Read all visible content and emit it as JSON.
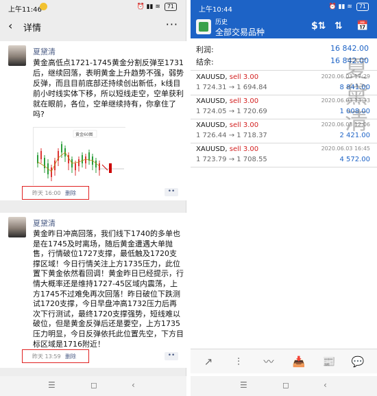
{
  "left": {
    "status": {
      "time": "上午11:46",
      "battery": "71"
    },
    "nav": {
      "back": "‹",
      "title": "详情",
      "more": "···"
    },
    "posts": [
      {
        "user": "夏黛清",
        "text": "黄金高低点1721-1745黄金分割反弹至1731后，继续回落，表明黄金上升趋势不强，弱势反弹，而且目前底部还持续创出新低，k线目前小时线实体下移，所以短线走空，空单获利就在眼前，各位，空单继续持有，你拿住了吗?",
        "time": "昨天 16:00",
        "delete": "删除",
        "chart_caption": "黄金60图"
      },
      {
        "user": "夏黛清",
        "text": "黄金昨日冲高回落，我们线下1740的多单也是在1745及时离场，随后黄金遭遇大单抛售，行情破位1727支撑，最低触及1720支撑区域！今日行情关注上方1735压力，此位置下黄金依然看回调！黄金昨日已经提示，行情大概率还是维持1727-45区域内震荡，上方1745不过难免再次回落！昨日破位下跌测试1720支撑，今日早盘冲高1732压力后再次下行测试，最终1720支撑强势，短线难以破位，但是黄金反弹后还是要空，上方1735压力明显，今日反弹依托此位置先空，下方目标区域是1716附近！",
        "time": "昨天 13:59",
        "delete": "删除"
      }
    ],
    "dots": "••",
    "nav_buttons": [
      "☰",
      "◻",
      "‹"
    ]
  },
  "right": {
    "status": {
      "time": "上午10:44",
      "battery": "71"
    },
    "bar": {
      "sub": "历史",
      "main": "全部交易品种",
      "icons": [
        "$⇅",
        "⇅",
        "📅"
      ]
    },
    "summary": [
      {
        "label": "利润:",
        "value": "16 842.00"
      },
      {
        "label": "结余:",
        "value": "16 842.00"
      }
    ],
    "trades": [
      {
        "symbol": "XAUUSD,",
        "side": "sell 3.00",
        "prices": "1 724.31 → 1 694.84",
        "date": "2020.06.03 17:29",
        "profit": "8 841.00"
      },
      {
        "symbol": "XAUUSD,",
        "side": "sell 3.00",
        "prices": "1 724.05 → 1 720.69",
        "date": "2020.06.03 13:33",
        "profit": "1 008.00"
      },
      {
        "symbol": "XAUUSD,",
        "side": "sell 3.00",
        "prices": "1 726.44 → 1 718.37",
        "date": "2020.06.03 12:06",
        "profit": "2 421.00"
      },
      {
        "symbol": "XAUUSD,",
        "side": "sell 3.00",
        "prices": "1 723.79 → 1 708.55",
        "date": "2020.06.03 16:45",
        "profit": "4 572.00"
      }
    ],
    "watermark": [
      "夏",
      "黛",
      "清"
    ],
    "toolbar": [
      "↗",
      "⫶",
      "〰",
      "📥",
      "📰",
      "💬"
    ],
    "nav_buttons": [
      "☰",
      "◻",
      "‹"
    ]
  }
}
